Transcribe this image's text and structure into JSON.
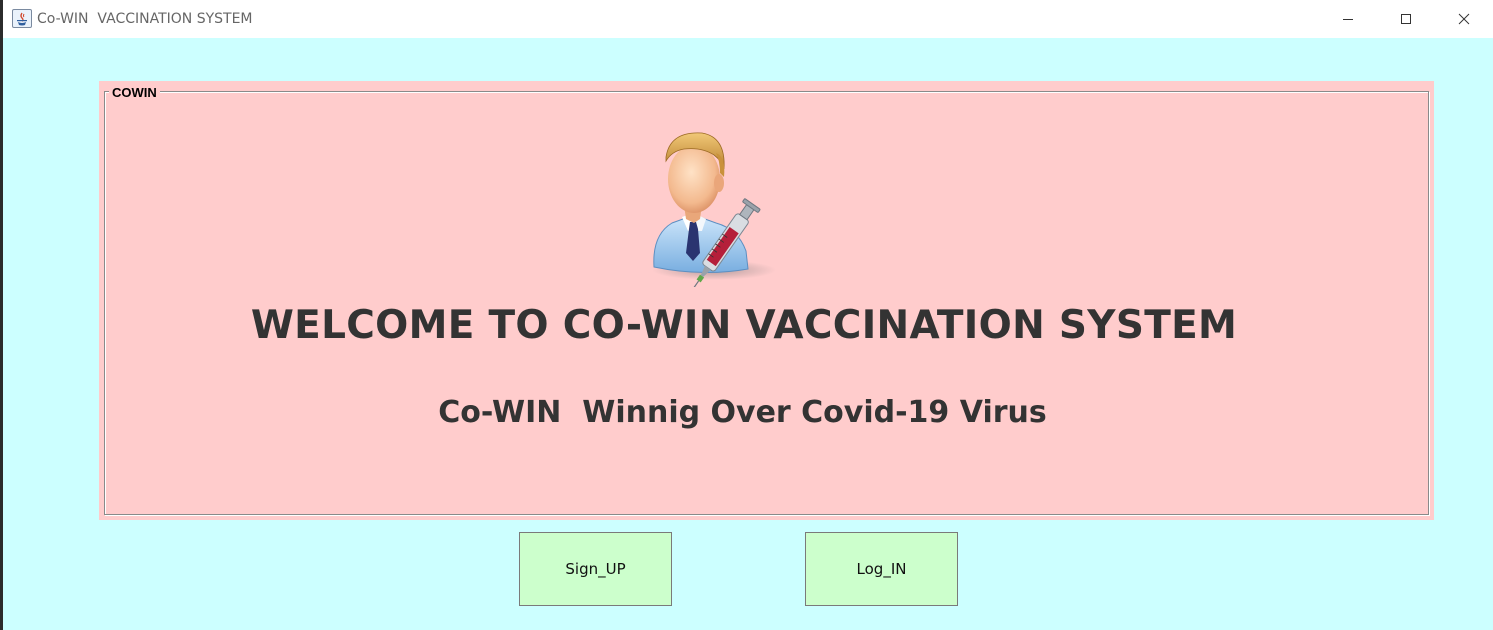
{
  "window": {
    "title": "Co-WIN  VACCINATION SYSTEM",
    "controls": {
      "minimize": "minimize-icon",
      "maximize": "maximize-icon",
      "close": "close-icon"
    }
  },
  "panel": {
    "legend": "COWIN",
    "icon": "doctor-with-syringe-icon",
    "heading": "WELCOME TO CO-WIN VACCINATION SYSTEM",
    "tagline": "Co-WIN  Winnig Over Covid-19 Virus"
  },
  "buttons": {
    "signup_label": "Sign_UP",
    "login_label": "Log_IN"
  },
  "colors": {
    "window_background": "#ccffff",
    "panel_background": "#ffcccc",
    "button_background": "#ccffcc",
    "text": "#333333"
  }
}
